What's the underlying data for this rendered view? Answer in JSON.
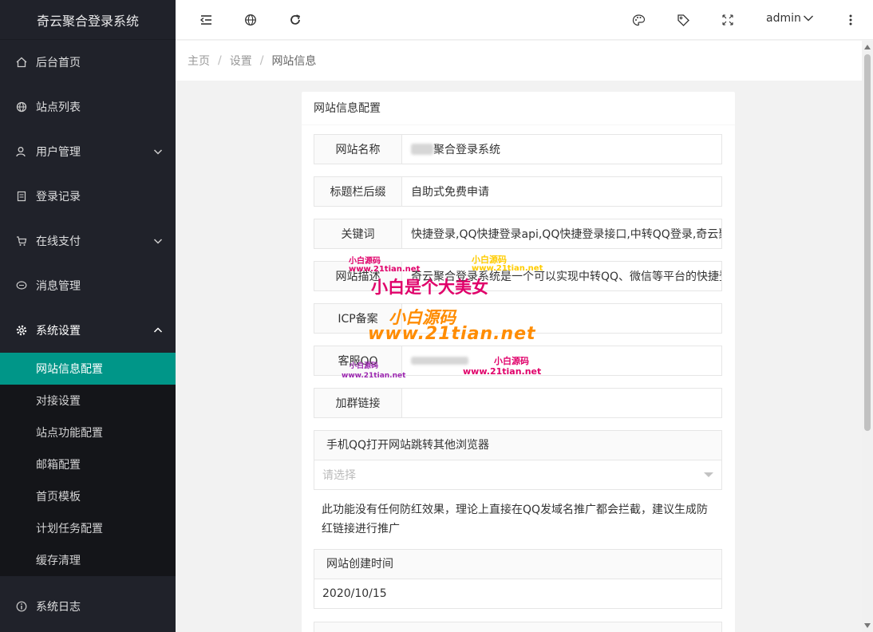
{
  "sidebar": {
    "logo": "奇云聚合登录系统",
    "items": [
      {
        "label": "后台首页",
        "icon": "home-icon"
      },
      {
        "label": "站点列表",
        "icon": "globe-icon"
      },
      {
        "label": "用户管理",
        "icon": "user-icon"
      },
      {
        "label": "登录记录",
        "icon": "document-icon"
      },
      {
        "label": "在线支付",
        "icon": "cart-icon"
      },
      {
        "label": "消息管理",
        "icon": "chat-icon"
      },
      {
        "label": "系统设置",
        "icon": "gear-icon"
      }
    ],
    "sub_items": [
      "网站信息配置",
      "对接设置",
      "站点功能配置",
      "邮箱配置",
      "首页模板",
      "计划任务配置",
      "缓存清理"
    ],
    "bottom_item": {
      "label": "系统日志",
      "icon": "info-icon"
    }
  },
  "header": {
    "user": "admin"
  },
  "breadcrumb": [
    "主页",
    "设置",
    "网站信息"
  ],
  "card": {
    "title": "网站信息配置",
    "fields": [
      {
        "label": "网站名称",
        "value": "聚合登录系统"
      },
      {
        "label": "标题栏后缀",
        "value": "自助式免费申请"
      },
      {
        "label": "关键词",
        "value": "快捷登录,QQ快捷登录api,QQ快捷登录接口,中转QQ登录,奇云聚"
      },
      {
        "label": "网站描述",
        "value": "奇云聚合登录系统是一个可以实现中转QQ、微信等平台的快捷登"
      },
      {
        "label": "ICP备案",
        "value": ""
      },
      {
        "label": "客服QQ",
        "value": ""
      },
      {
        "label": "加群链接",
        "value": ""
      }
    ],
    "browser_section": {
      "title": "手机QQ打开网站跳转其他浏览器",
      "placeholder": "请选择"
    },
    "note": "此功能没有任何防红效果，理论上直接在QQ发域名推广都会拦截，建议生成防红链接进行推广",
    "date_section": {
      "title": "网站创建时间",
      "value": "2020/10/15"
    }
  },
  "watermarks": {
    "small_a": "小白源码",
    "small_url": "www.21tian.net",
    "headline": "小白是个大美女",
    "big_name": "小白源码",
    "big_url": "www.21tian.net"
  },
  "colors": {
    "sidebar": "#20222a",
    "active": "#009688"
  }
}
